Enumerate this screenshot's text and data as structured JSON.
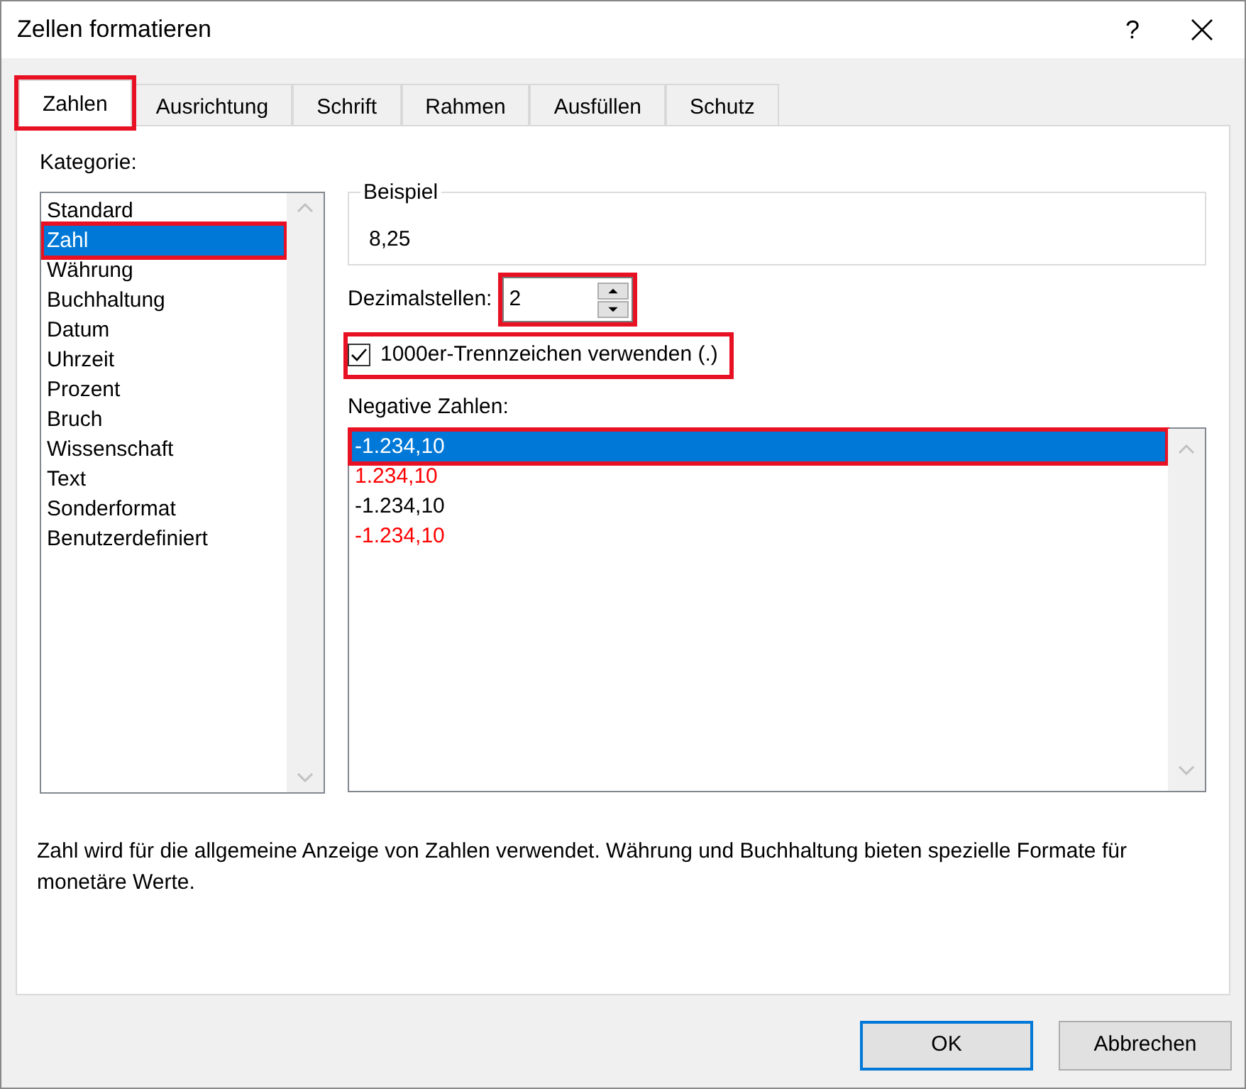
{
  "window": {
    "title": "Zellen formatieren",
    "help": "?"
  },
  "tabs": [
    {
      "label": "Zahlen",
      "selected": true,
      "highlighted": true
    },
    {
      "label": "Ausrichtung",
      "selected": false,
      "highlighted": false
    },
    {
      "label": "Schrift",
      "selected": false,
      "highlighted": false
    },
    {
      "label": "Rahmen",
      "selected": false,
      "highlighted": false
    },
    {
      "label": "Ausfüllen",
      "selected": false,
      "highlighted": false
    },
    {
      "label": "Schutz",
      "selected": false,
      "highlighted": false
    }
  ],
  "category": {
    "label": "Kategorie:",
    "items": [
      {
        "label": "Standard",
        "selected": false,
        "highlighted": false
      },
      {
        "label": "Zahl",
        "selected": true,
        "highlighted": true
      },
      {
        "label": "Währung",
        "selected": false,
        "highlighted": false
      },
      {
        "label": "Buchhaltung",
        "selected": false,
        "highlighted": false
      },
      {
        "label": "Datum",
        "selected": false,
        "highlighted": false
      },
      {
        "label": "Uhrzeit",
        "selected": false,
        "highlighted": false
      },
      {
        "label": "Prozent",
        "selected": false,
        "highlighted": false
      },
      {
        "label": "Bruch",
        "selected": false,
        "highlighted": false
      },
      {
        "label": "Wissenschaft",
        "selected": false,
        "highlighted": false
      },
      {
        "label": "Text",
        "selected": false,
        "highlighted": false
      },
      {
        "label": "Sonderformat",
        "selected": false,
        "highlighted": false
      },
      {
        "label": "Benutzerdefiniert",
        "selected": false,
        "highlighted": false
      }
    ]
  },
  "sample": {
    "label": "Beispiel",
    "value": "8,25"
  },
  "decimals": {
    "label": "Dezimalstellen:",
    "value": "2",
    "highlighted": true
  },
  "separator": {
    "label": "1000er-Trennzeichen verwenden (.)",
    "checked": true,
    "highlighted": true
  },
  "negative": {
    "label": "Negative Zahlen:",
    "items": [
      {
        "label": "-1.234,10",
        "selected": true,
        "highlighted": true
      },
      {
        "label": "1.234,10",
        "color": "#ff0000",
        "selected": false,
        "highlighted": false
      },
      {
        "label": "-1.234,10",
        "color": "#000000",
        "selected": false,
        "highlighted": false
      },
      {
        "label": "-1.234,10",
        "color": "#ff0000",
        "selected": false,
        "highlighted": false
      }
    ]
  },
  "description": "Zahl wird für die allgemeine Anzeige von Zahlen verwendet. Währung und Buchhaltung bieten spezielle Formate für monetäre Werte.",
  "buttons": [
    {
      "label": "OK",
      "default": true
    },
    {
      "label": "Abbrechen",
      "default": false
    }
  ]
}
